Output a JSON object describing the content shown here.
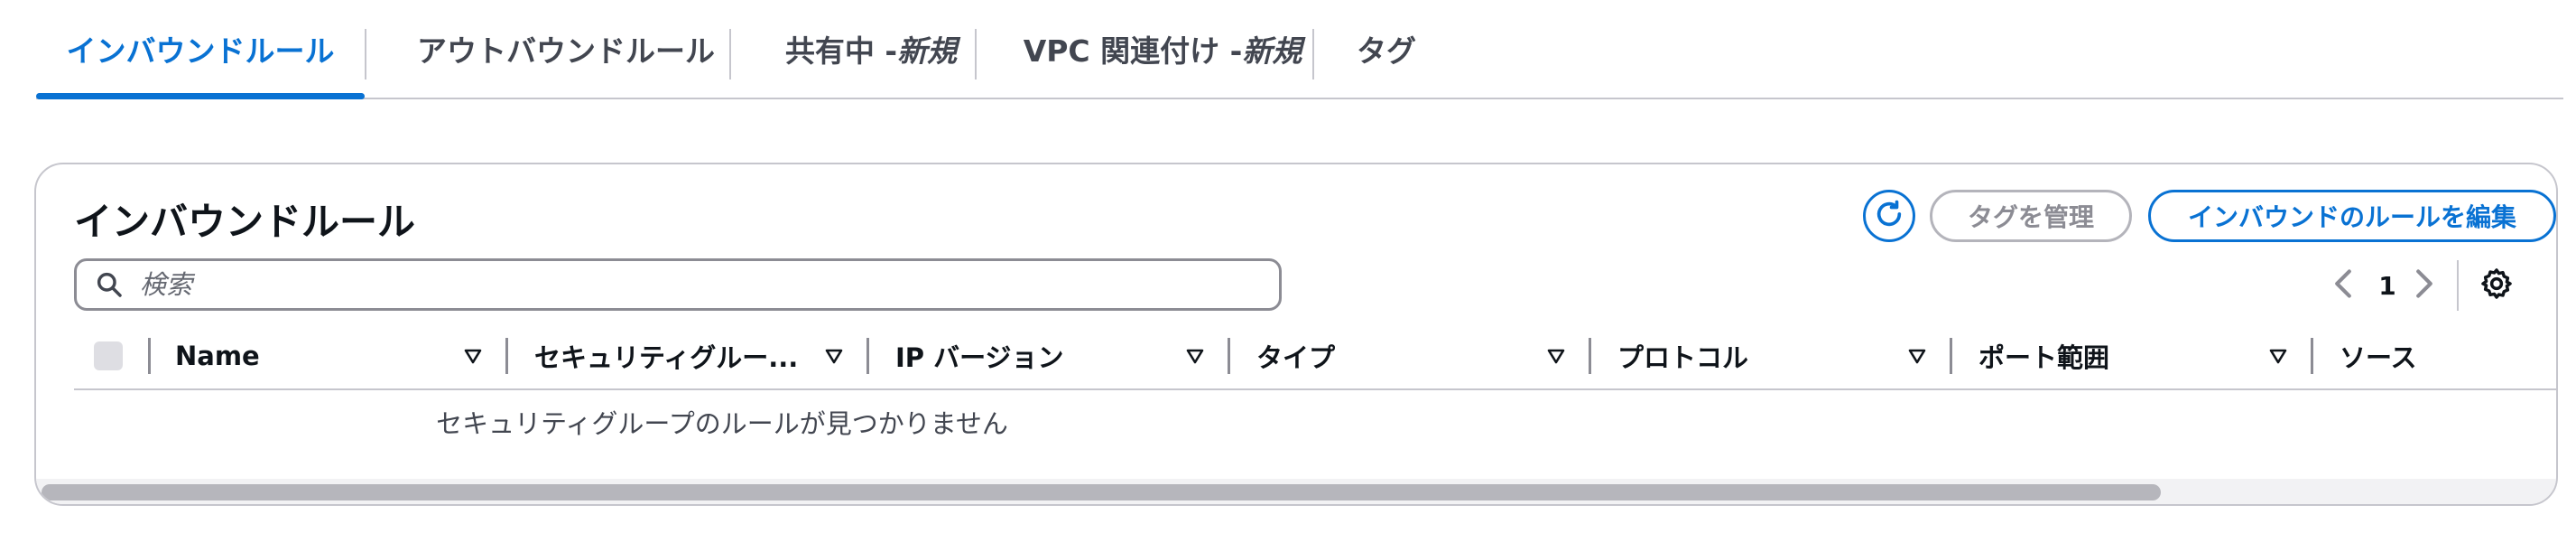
{
  "tabs": [
    {
      "label": "インバウンドルール",
      "active": true
    },
    {
      "label": "アウトバウンドルール"
    },
    {
      "label": "共有中 - ",
      "badge": "新規"
    },
    {
      "label": "VPC 関連付け - ",
      "badge": "新規"
    },
    {
      "label": "タグ"
    }
  ],
  "panel": {
    "title": "インバウンドルール",
    "manage_tags_label": "タグを管理",
    "edit_rules_label": "インバウンドのルールを編集"
  },
  "search": {
    "placeholder": "検索",
    "value": ""
  },
  "pagination": {
    "current_page": "1"
  },
  "table": {
    "columns": [
      "Name",
      "セキュリティグルー...",
      "IP バージョン",
      "タイプ",
      "プロトコル",
      "ポート範囲",
      "ソース"
    ],
    "empty_message": "セキュリティグループのルールが見つかりません"
  },
  "colors": {
    "accent": "#0972d3",
    "border": "#c6c6cd",
    "text": "#0f141a"
  },
  "icons": [
    "refresh-icon",
    "search-icon",
    "chevron-left-icon",
    "chevron-right-icon",
    "gear-icon",
    "sort-caret-icon"
  ]
}
